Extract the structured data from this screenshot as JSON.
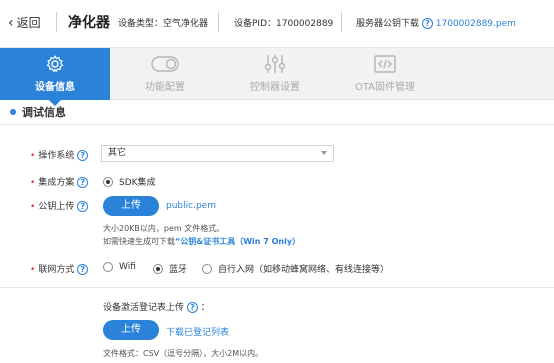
{
  "header": {
    "back_label": "返回",
    "title": "净化器",
    "device_type": "设备类型：空气净化器",
    "device_pid": "设备PID：1700002889",
    "server_key_label": "服务器公钥下载",
    "server_key_file": "1700002889.pem"
  },
  "tabs": [
    {
      "label": "设备信息",
      "icon": "gear-icon",
      "active": true
    },
    {
      "label": "功能配置",
      "icon": "toggle-icon",
      "active": false
    },
    {
      "label": "控制器设置",
      "icon": "sliders-icon",
      "active": false
    },
    {
      "label": "OTA固件管理",
      "icon": "firmware-icon",
      "active": false
    }
  ],
  "section": {
    "title": "调试信息"
  },
  "form": {
    "os": {
      "label": "操作系统",
      "value": "其它"
    },
    "integration": {
      "label": "集成方案",
      "option": "SDK集成"
    },
    "key_upload": {
      "label": "公钥上传",
      "button": "上传",
      "file": "public.pem",
      "hint1": "大小20KB以内，pem 文件格式。",
      "hint2_prefix": "如需快速生成可下载",
      "hint2_tool": "“公钥&证书工具（Win 7 Only）"
    },
    "network": {
      "label": "联网方式",
      "options": [
        "Wifi",
        "蓝牙",
        "自行入网（如移动蜂窝网络、有线连接等）"
      ],
      "selected": 1
    },
    "activation": {
      "label": "设备激活登记表上传",
      "button": "上传",
      "download": "下载已登记列表",
      "hint": "文件格式：CSV（逗号分隔），大小2M以内。"
    }
  },
  "colors": {
    "accent": "#2b82d9",
    "required": "#e33333"
  }
}
